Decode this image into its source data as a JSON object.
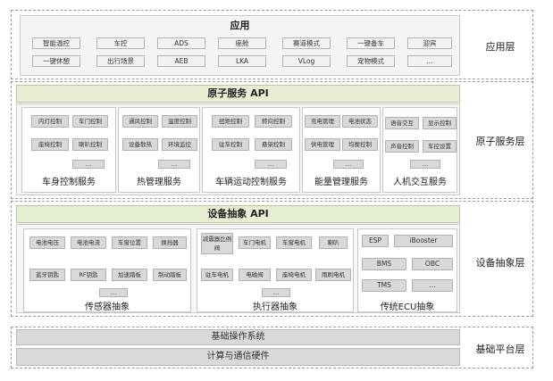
{
  "layers": {
    "app": "应用层",
    "atomic": "原子服务层",
    "device": "设备抽象层",
    "base": "基础平台层"
  },
  "app": {
    "title": "应用",
    "row1": [
      "智能温控",
      "车控",
      "ADS",
      "座舱",
      "赛道模式",
      "一键备车",
      "迎宾"
    ],
    "row2": [
      "一键休憩",
      "出行场景",
      "AEB",
      "LKA",
      "VLog",
      "宠物模式",
      "..."
    ]
  },
  "atomic": {
    "api": "原子服务 API",
    "groups": [
      {
        "label": "车身控制服务",
        "items": [
          "内灯控制",
          "车门控制",
          "座椅控制",
          "喇叭控制"
        ],
        "more": "..."
      },
      {
        "label": "热管理服务",
        "items": [
          "通风控制",
          "温度控制",
          "设备散热",
          "环境监控"
        ],
        "more": "..."
      },
      {
        "label": "车辆运动控制服务",
        "items": [
          "扭矩控制",
          "转向控制",
          "驻车控制",
          "悬架控制"
        ],
        "more": "..."
      },
      {
        "label": "能量管理服务",
        "items": [
          "充电管理",
          "电池状态",
          "供电管理",
          "均衡控制"
        ],
        "more": "..."
      },
      {
        "label": "人机交互服务",
        "items": [
          "语音交互",
          "显示控制",
          "声音控制",
          "车控设置"
        ],
        "more": "..."
      }
    ]
  },
  "device": {
    "api": "设备抽象 API",
    "sensor": {
      "label": "传感器抽象",
      "row1": [
        "电池电压",
        "电池电流",
        "车窗位置",
        "换挡器"
      ],
      "row2": [
        "蓝牙钥匙",
        "RF钥匙",
        "加速踏板",
        "制动踏板"
      ],
      "more": "..."
    },
    "actuator": {
      "label": "执行器抽象",
      "row1": [
        "减震器比例阀",
        "车门电机",
        "车窗电机",
        "喇叭"
      ],
      "row2": [
        "驻车电机",
        "电磁阀",
        "座椅电机",
        "雨刷电机"
      ],
      "more": "..."
    },
    "ecu": {
      "label": "传统ECU抽象",
      "items": [
        "ESP",
        "iBooster",
        "BMS",
        "OBC",
        "TMS",
        "..."
      ]
    }
  },
  "base": {
    "os": "基础操作系统",
    "hw": "计算与通信硬件"
  }
}
